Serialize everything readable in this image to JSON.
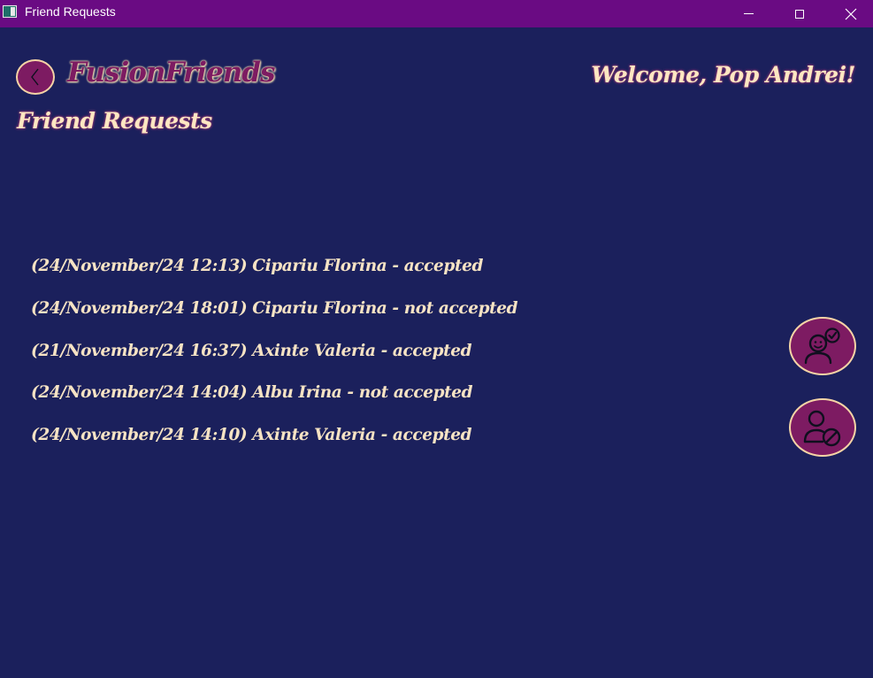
{
  "window": {
    "title": "Friend Requests",
    "icon": "app-window-icon",
    "controls": [
      "minimize-icon",
      "maximize-icon",
      "close-icon"
    ]
  },
  "header": {
    "back_icon": "chevron-left-icon",
    "brand": "FusionFriends",
    "welcome": "Welcome,  Pop Andrei!",
    "page_title": "Friend Requests"
  },
  "requests": [
    {
      "text": "(24/November/24 12:13) Cipariu Florina - accepted"
    },
    {
      "text": "(24/November/24 18:01) Cipariu Florina - not accepted"
    },
    {
      "text": "(21/November/24 16:37) Axinte Valeria - accepted"
    },
    {
      "text": "(24/November/24 14:04) Albu Irina - not accepted"
    },
    {
      "text": "(24/November/24 14:10) Axinte Valeria - accepted"
    }
  ],
  "actions": {
    "accept_icon": "accept-friend-icon",
    "reject_icon": "block-friend-icon"
  },
  "colors": {
    "background": "#1b205c",
    "titlebar": "#6a0b83",
    "accent": "#7d1b62",
    "text": "#fde7c2"
  }
}
